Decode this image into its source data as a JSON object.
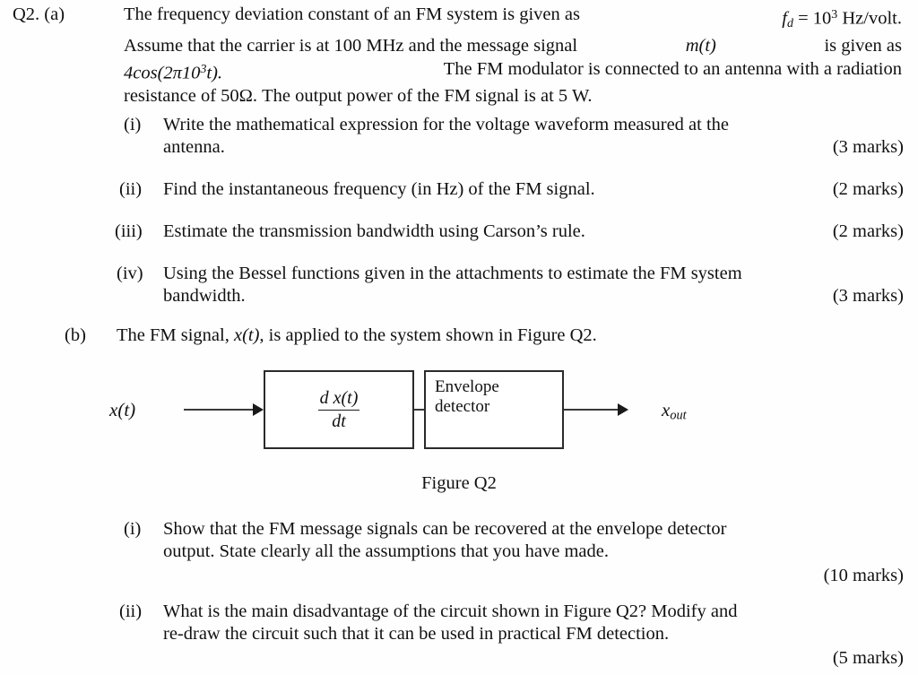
{
  "document": {
    "question_label": "Q2. (a)",
    "part_b_label": "(b)",
    "figure_caption": "Figure Q2"
  },
  "part_a": {
    "line1_a": "The  frequency  deviation  constant  of  an  FM  system  is  given  as",
    "line1_math_f": "f",
    "line1_math_sub": "d",
    "line1_math_eq": " = 10",
    "line1_math_sup": "3",
    "line1_math_tail": " Hz/volt.",
    "line2": "Assume  that  the  carrier  is  at  100  MHz  and  the  message  signal",
    "line2_math_m": "m(t)",
    "line2_tail": "is  given  as",
    "line3_math": "4cos(2π10",
    "line3_math_sup": "3",
    "line3_math_tail": "t).",
    "line3_rest": "The  FM  modulator  is  connected  to  an  antenna  with  a  radiation",
    "line4": "resistance of 50Ω. The output power of the FM signal is at 5 W."
  },
  "part_a_items": [
    {
      "num": "(i)",
      "text_line1": "Write  the  mathematical  expression  for  the  voltage  waveform  measured  at  the",
      "text_line2": "antenna.",
      "marks": "(3 marks)"
    },
    {
      "num": "(ii)",
      "text_line1": "Find the instantaneous frequency (in Hz) of the FM signal.",
      "text_line2": "",
      "marks": "(2 marks)"
    },
    {
      "num": "(iii)",
      "text_line1": "Estimate the transmission bandwidth using Carson’s rule.",
      "text_line2": "",
      "marks": "(2 marks)"
    },
    {
      "num": "(iv)",
      "text_line1": "Using  the  Bessel  functions  given  in  the  attachments  to  estimate  the  FM  system",
      "text_line2": "bandwidth.",
      "marks": "(3 marks)"
    }
  ],
  "part_b": {
    "intro_pre": "The FM signal, ",
    "intro_math": "x(t)",
    "intro_post": ", is applied to the system shown in Figure Q2."
  },
  "figure": {
    "input_label_base": "x(t)",
    "output_label_base": "x",
    "output_label_sub": "out",
    "block_diff_num": "d x(t)",
    "block_diff_den": "dt",
    "block_env_line1": "Envelope",
    "block_env_line2": "detector"
  },
  "part_b_items": [
    {
      "num": "(i)",
      "text_line1": "Show  that  the  FM  message  signals  can  be  recovered  at  the  envelope  detector",
      "text_line2": "output. State clearly all the assumptions that you have made.",
      "marks": "(10 marks)"
    },
    {
      "num": "(ii)",
      "text_line1": "What is the main disadvantage of the circuit shown in Figure Q2? Modify and",
      "text_line2": "re-draw the circuit such that it can be used in practical FM detection.",
      "marks": "(5 marks)"
    }
  ]
}
